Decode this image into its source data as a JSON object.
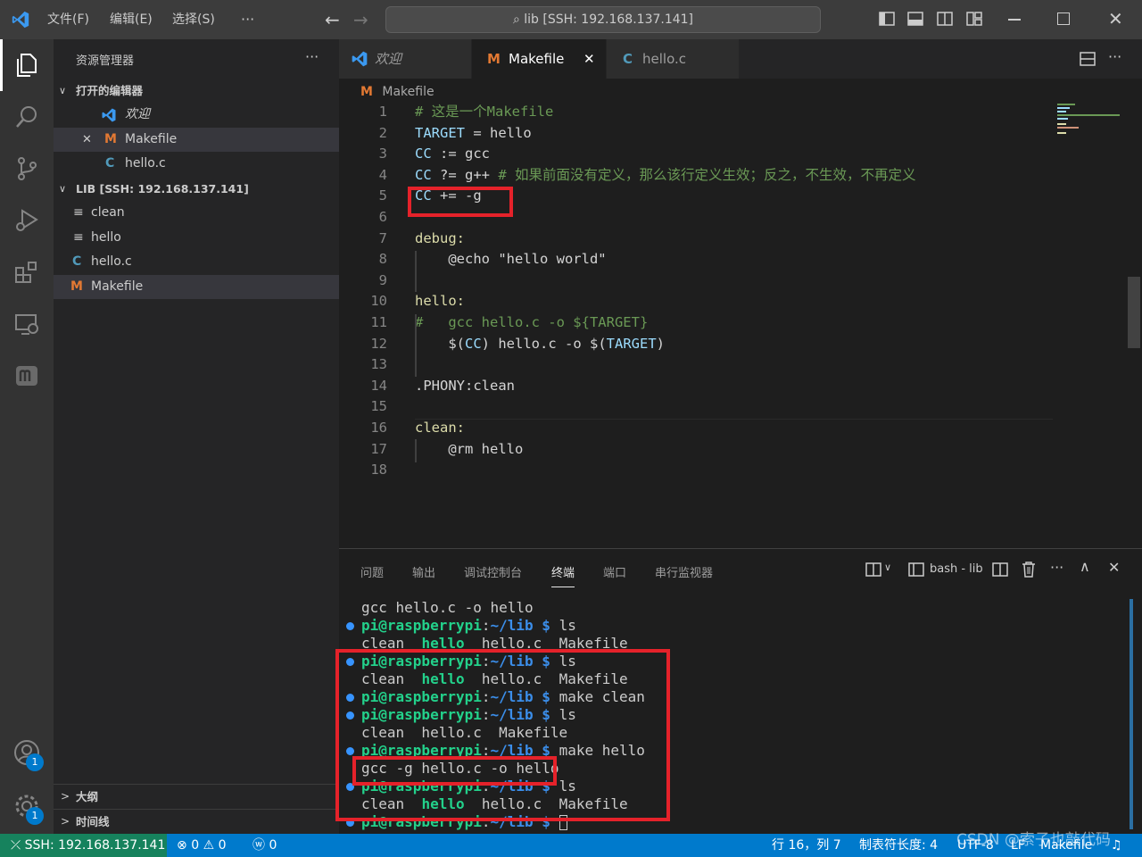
{
  "titlebar": {
    "menus": [
      "文件(F)",
      "编辑(E)",
      "选择(S)",
      "···"
    ],
    "command_center": "lib [SSH: 192.168.137.141]"
  },
  "sidebar": {
    "title": "资源管理器",
    "more": "···",
    "open_editors_header": "打开的编辑器",
    "open_editors": [
      {
        "label": "欢迎",
        "icon": "vscode-icon"
      },
      {
        "label": "Makefile",
        "icon": "makefile-icon"
      },
      {
        "label": "hello.c",
        "icon": "c-icon"
      }
    ],
    "folder_header": "LIB [SSH: 192.168.137.141]",
    "files": [
      {
        "label": "clean",
        "icon": "file-lines-icon"
      },
      {
        "label": "hello",
        "icon": "file-lines-icon"
      },
      {
        "label": "hello.c",
        "icon": "c-icon"
      },
      {
        "label": "Makefile",
        "icon": "makefile-icon"
      }
    ],
    "outline": "大纲",
    "timeline": "时间线"
  },
  "tabs": [
    {
      "label": "欢迎",
      "icon": "vscode-icon"
    },
    {
      "label": "Makefile",
      "icon": "makefile-icon",
      "active": true
    },
    {
      "label": "hello.c",
      "icon": "c-icon"
    }
  ],
  "breadcrumb": "Makefile",
  "editor": {
    "line_numbers": [
      "1",
      "2",
      "3",
      "4",
      "5",
      "6",
      "7",
      "8",
      "9",
      "10",
      "11",
      "12",
      "13",
      "14",
      "15",
      "16",
      "17",
      "18"
    ],
    "lines": [
      [
        {
          "t": "# 这是一个Makefile",
          "c": "cmt"
        }
      ],
      [
        {
          "t": "TARGET",
          "c": "var"
        },
        {
          "t": " = hello",
          "c": "plain"
        }
      ],
      [
        {
          "t": "CC",
          "c": "var"
        },
        {
          "t": " := gcc",
          "c": "plain"
        }
      ],
      [
        {
          "t": "CC",
          "c": "var"
        },
        {
          "t": " ?= g++ ",
          "c": "plain"
        },
        {
          "t": "# 如果前面没有定义，那么该行定义生效；反之，不生效，不再定义",
          "c": "cmt"
        }
      ],
      [
        {
          "t": "CC",
          "c": "var"
        },
        {
          "t": " += -g",
          "c": "plain"
        }
      ],
      [],
      [
        {
          "t": "debug:",
          "c": "tgt"
        }
      ],
      [
        {
          "t": "    @echo \"hello world\"",
          "c": "plain"
        }
      ],
      [],
      [
        {
          "t": "hello:",
          "c": "tgt"
        }
      ],
      [
        {
          "t": "#   gcc hello.c -o ${TARGET}",
          "c": "cmt"
        }
      ],
      [
        {
          "t": "    $(",
          "c": "plain"
        },
        {
          "t": "CC",
          "c": "var"
        },
        {
          "t": ") hello.c -o $(",
          "c": "plain"
        },
        {
          "t": "TARGET",
          "c": "var"
        },
        {
          "t": ")",
          "c": "plain"
        }
      ],
      [],
      [
        {
          "t": ".PHONY",
          "c": "plain"
        },
        {
          "t": ":clean",
          "c": "plain"
        }
      ],
      [],
      [
        {
          "t": "clean:",
          "c": "tgt"
        }
      ],
      [
        {
          "t": "    @rm hello",
          "c": "plain"
        }
      ],
      []
    ]
  },
  "panel": {
    "tabs": [
      "问题",
      "输出",
      "调试控制台",
      "终端",
      "端口",
      "串行监视器"
    ],
    "active_tab": "终端",
    "terminal_name": "bash - lib",
    "lines": [
      [
        {
          "t": "gcc hello.c -o hello",
          "c": ""
        }
      ],
      [
        {
          "t": "pi@raspberrypi",
          "c": "prompt"
        },
        {
          "t": ":",
          "c": ""
        },
        {
          "t": "~/lib $",
          "c": "path"
        },
        {
          "t": " ls",
          "c": ""
        }
      ],
      [
        {
          "t": "clean  ",
          "c": ""
        },
        {
          "t": "hello",
          "c": "hl"
        },
        {
          "t": "  hello.c  Makefile",
          "c": ""
        }
      ],
      [
        {
          "t": "pi@raspberrypi",
          "c": "prompt"
        },
        {
          "t": ":",
          "c": ""
        },
        {
          "t": "~/lib $",
          "c": "path"
        },
        {
          "t": " ls",
          "c": ""
        }
      ],
      [
        {
          "t": "clean  ",
          "c": ""
        },
        {
          "t": "hello",
          "c": "hl"
        },
        {
          "t": "  hello.c  Makefile",
          "c": ""
        }
      ],
      [
        {
          "t": "pi@raspberrypi",
          "c": "prompt"
        },
        {
          "t": ":",
          "c": ""
        },
        {
          "t": "~/lib $",
          "c": "path"
        },
        {
          "t": " make clean",
          "c": ""
        }
      ],
      [
        {
          "t": "pi@raspberrypi",
          "c": "prompt"
        },
        {
          "t": ":",
          "c": ""
        },
        {
          "t": "~/lib $",
          "c": "path"
        },
        {
          "t": " ls",
          "c": ""
        }
      ],
      [
        {
          "t": "clean  hello.c  Makefile",
          "c": ""
        }
      ],
      [
        {
          "t": "pi@raspberrypi",
          "c": "prompt"
        },
        {
          "t": ":",
          "c": ""
        },
        {
          "t": "~/lib $",
          "c": "path"
        },
        {
          "t": " make hello",
          "c": ""
        }
      ],
      [
        {
          "t": "gcc -g hello.c -o hello",
          "c": ""
        }
      ],
      [
        {
          "t": "pi@raspberrypi",
          "c": "prompt"
        },
        {
          "t": ":",
          "c": ""
        },
        {
          "t": "~/lib $",
          "c": "path"
        },
        {
          "t": " ls",
          "c": ""
        }
      ],
      [
        {
          "t": "clean  ",
          "c": ""
        },
        {
          "t": "hello",
          "c": "hl"
        },
        {
          "t": "  hello.c  Makefile",
          "c": ""
        }
      ],
      [
        {
          "t": "pi@raspberrypi",
          "c": "prompt"
        },
        {
          "t": ":",
          "c": ""
        },
        {
          "t": "~/lib $",
          "c": "path"
        },
        {
          "t": " ",
          "c": ""
        }
      ]
    ],
    "dots": [
      false,
      true,
      false,
      true,
      false,
      true,
      true,
      false,
      true,
      false,
      true,
      false,
      true
    ]
  },
  "statusbar": {
    "remote": "SSH: 192.168.137.141",
    "errors": "0",
    "warnings": "0",
    "ports": "0",
    "position": "行 16，列 7",
    "indent": "制表符长度: 4",
    "encoding": "UTF-8",
    "eol": "LF",
    "language": "Makefile",
    "watermark": "CSDN @索子也敲代码"
  },
  "badges": {
    "accounts": "1",
    "settings": "1"
  },
  "colors": {
    "accent": "#007acc",
    "remote": "#16825d",
    "annotation": "#e5222a"
  }
}
